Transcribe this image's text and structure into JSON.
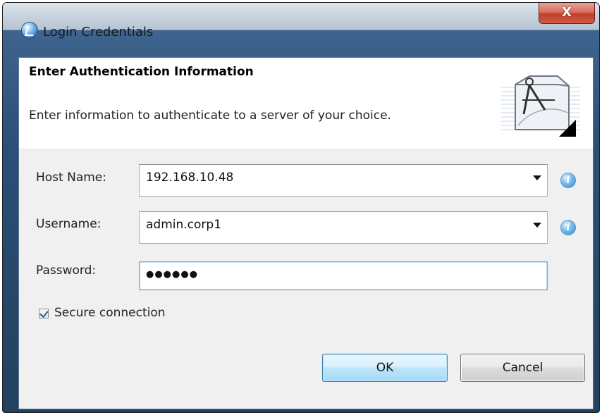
{
  "window": {
    "title": "Login Credentials",
    "close_label": "X"
  },
  "header": {
    "title": "Enter Authentication Information",
    "description": "Enter information to authenticate to a server of your choice."
  },
  "form": {
    "host": {
      "label": "Host Name:",
      "value": "192.168.10.48"
    },
    "username": {
      "label": "Username:",
      "value": "admin.corp1"
    },
    "password": {
      "label": "Password:",
      "masked_value": "●●●●●●"
    },
    "secure": {
      "label": "Secure connection",
      "checked": true
    }
  },
  "info_icon_glyph": "i",
  "buttons": {
    "ok": "OK",
    "cancel": "Cancel"
  },
  "icons": {
    "app": "eclipse-globe-icon",
    "banner": "compass-drafting-icon",
    "info": "info-icon",
    "dropdown": "chevron-down-icon"
  },
  "colors": {
    "titlebar": "#c9d4df",
    "close_button": "#c2402b",
    "ok_button_border": "#3c7fb1",
    "info_icon": "#2f86cf"
  }
}
